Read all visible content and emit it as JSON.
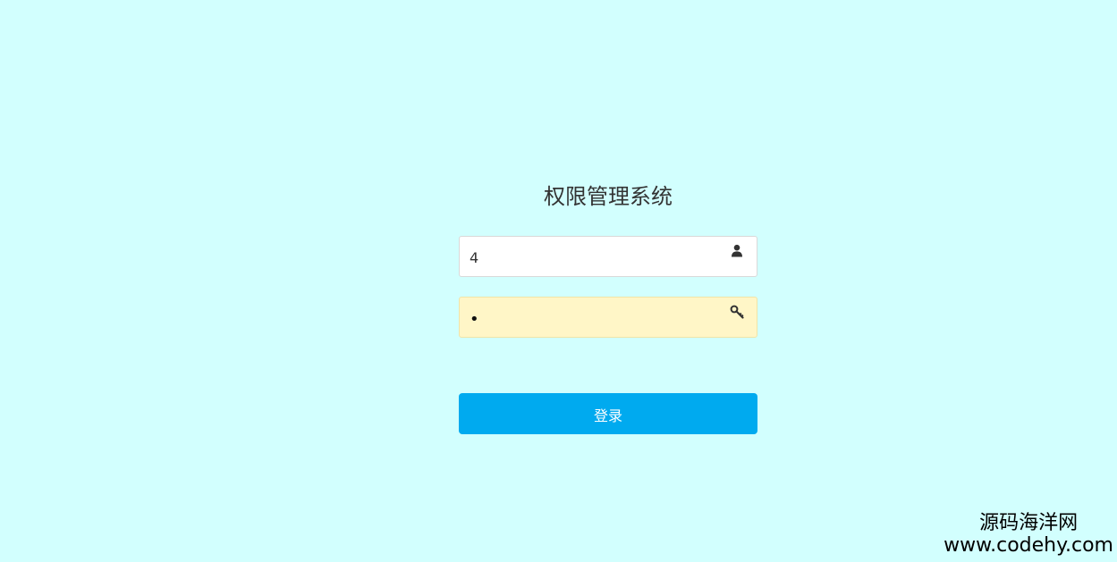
{
  "login": {
    "title": "权限管理系统",
    "username": {
      "value": "4",
      "icon": "user-icon"
    },
    "password": {
      "value": "•",
      "icon": "key-icon"
    },
    "submit_label": "登录"
  },
  "watermark": {
    "name": "源码海洋网",
    "url": "www.codehy.com"
  },
  "colors": {
    "background": "#d2fffe",
    "button": "#00aaef",
    "autofill": "#fff6c7"
  }
}
